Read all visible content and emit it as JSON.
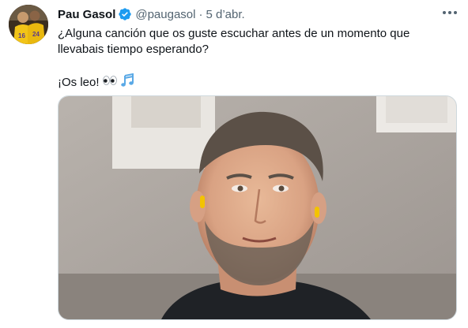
{
  "tweet": {
    "author_name": "Pau Gasol",
    "handle": "@paugasol",
    "separator": "·",
    "timestamp": "5 d’abr.",
    "text_line1": "¿Alguna canción que os guste escuchar antes de un momento que llevabais tiempo esperando?",
    "text_line2": "¡Os leo!",
    "icons": {
      "verified": "verified-badge-icon",
      "more": "more-options-icon",
      "emoji_1": "eyes-icon",
      "emoji_2": "musical-notes-icon"
    },
    "colors": {
      "text": "#0f1419",
      "secondary": "#536471",
      "verified": "#1d9bf0",
      "media_border": "#cfd9de"
    }
  }
}
